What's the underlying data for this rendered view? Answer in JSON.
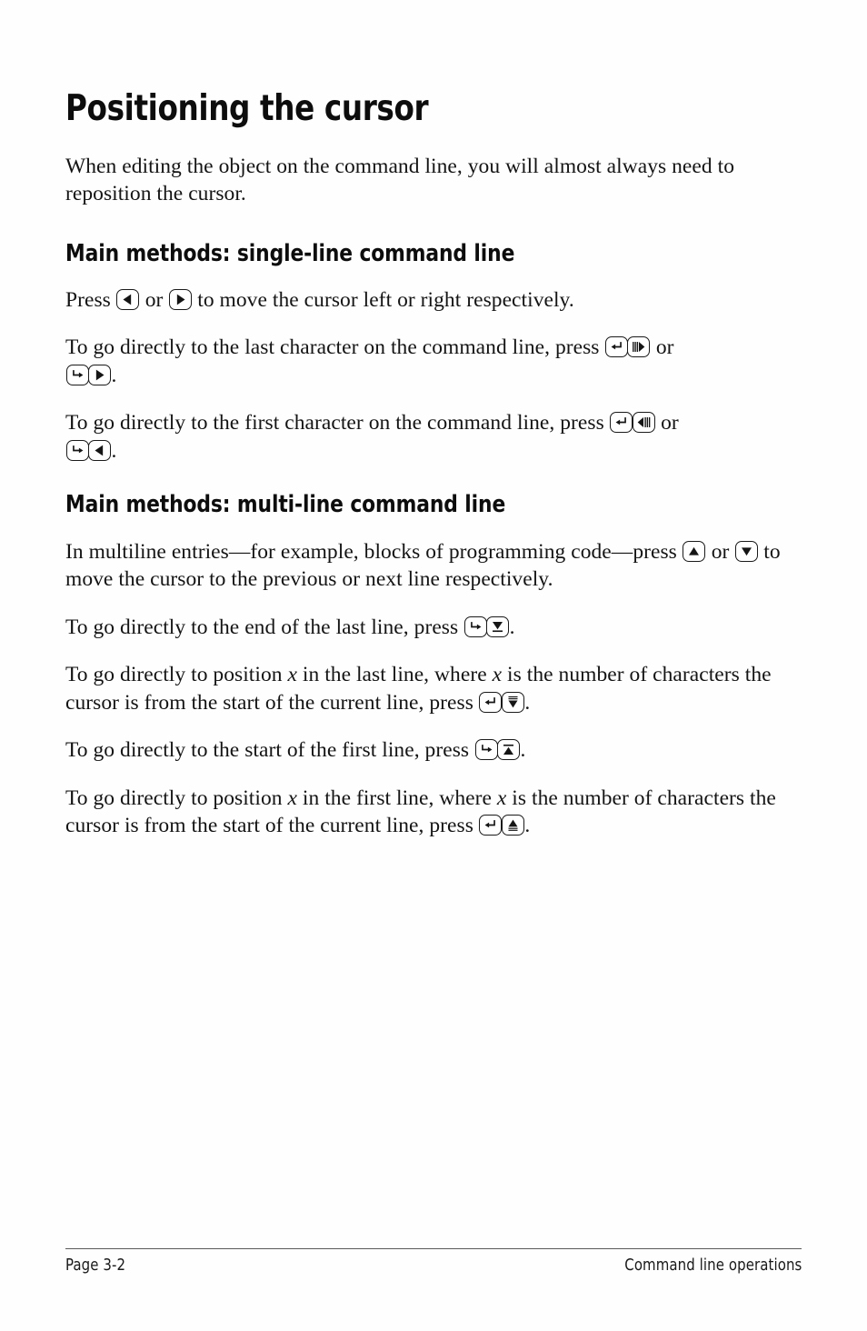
{
  "page": {
    "title": "Positioning the cursor",
    "intro": "When editing the object on the command line, you will almost always need to reposition the cursor."
  },
  "sections": [
    {
      "heading": "Main methods: single-line command line",
      "paragraphs": [
        {
          "p1": "Press ",
          "p2": " or ",
          "p3": " to move the cursor left or right respectively."
        },
        {
          "p1": "To go directly to the last character on the command line, press ",
          "p2": " or ",
          "p3": "."
        },
        {
          "p1": "To go directly to the first character on the command line, press ",
          "p2": " or ",
          "p3": "."
        }
      ]
    },
    {
      "heading": "Main methods: multi-line command line",
      "paragraphs": [
        {
          "p1": "In multiline entries—for example, blocks of programming code—press ",
          "p2": " or ",
          "p3": " to move the cursor to the previous or next line respectively."
        },
        {
          "p1": "To go directly to the end of the last line, press ",
          "p2": "."
        },
        {
          "p1": "To go directly to position ",
          "var1": "x",
          "p2": " in the last line, where ",
          "var2": "x",
          "p3": " is the number of characters the cursor is from the start of the current line, press ",
          "p4": "."
        },
        {
          "p1": "To go directly to the start of the first line, press ",
          "p2": "."
        },
        {
          "p1": "To go directly to position ",
          "var1": "x",
          "p2": " in the first line, where ",
          "var2": "x",
          "p3": " is the number of characters the cursor is from the start of the current line, press ",
          "p4": "."
        }
      ]
    }
  ],
  "keys": {
    "left_arrow": "left-arrow-key",
    "right_arrow": "right-arrow-key",
    "up_arrow": "up-arrow-key",
    "down_arrow": "down-arrow-key",
    "left_shift": "left-shift-key",
    "right_shift": "right-shift-key",
    "skip_right": "skip-to-end-right-key",
    "skip_left": "skip-to-start-left-key",
    "down_bar": "down-to-end-key",
    "down_bars": "down-to-position-key",
    "up_bar": "up-to-start-key",
    "up_bars": "up-to-position-key"
  },
  "footer": {
    "page_number": "Page 3-2",
    "chapter": "Command line operations"
  },
  "colors": {
    "ink": "#111111",
    "paper": "#fefefe",
    "rule": "#5a5a5a"
  }
}
